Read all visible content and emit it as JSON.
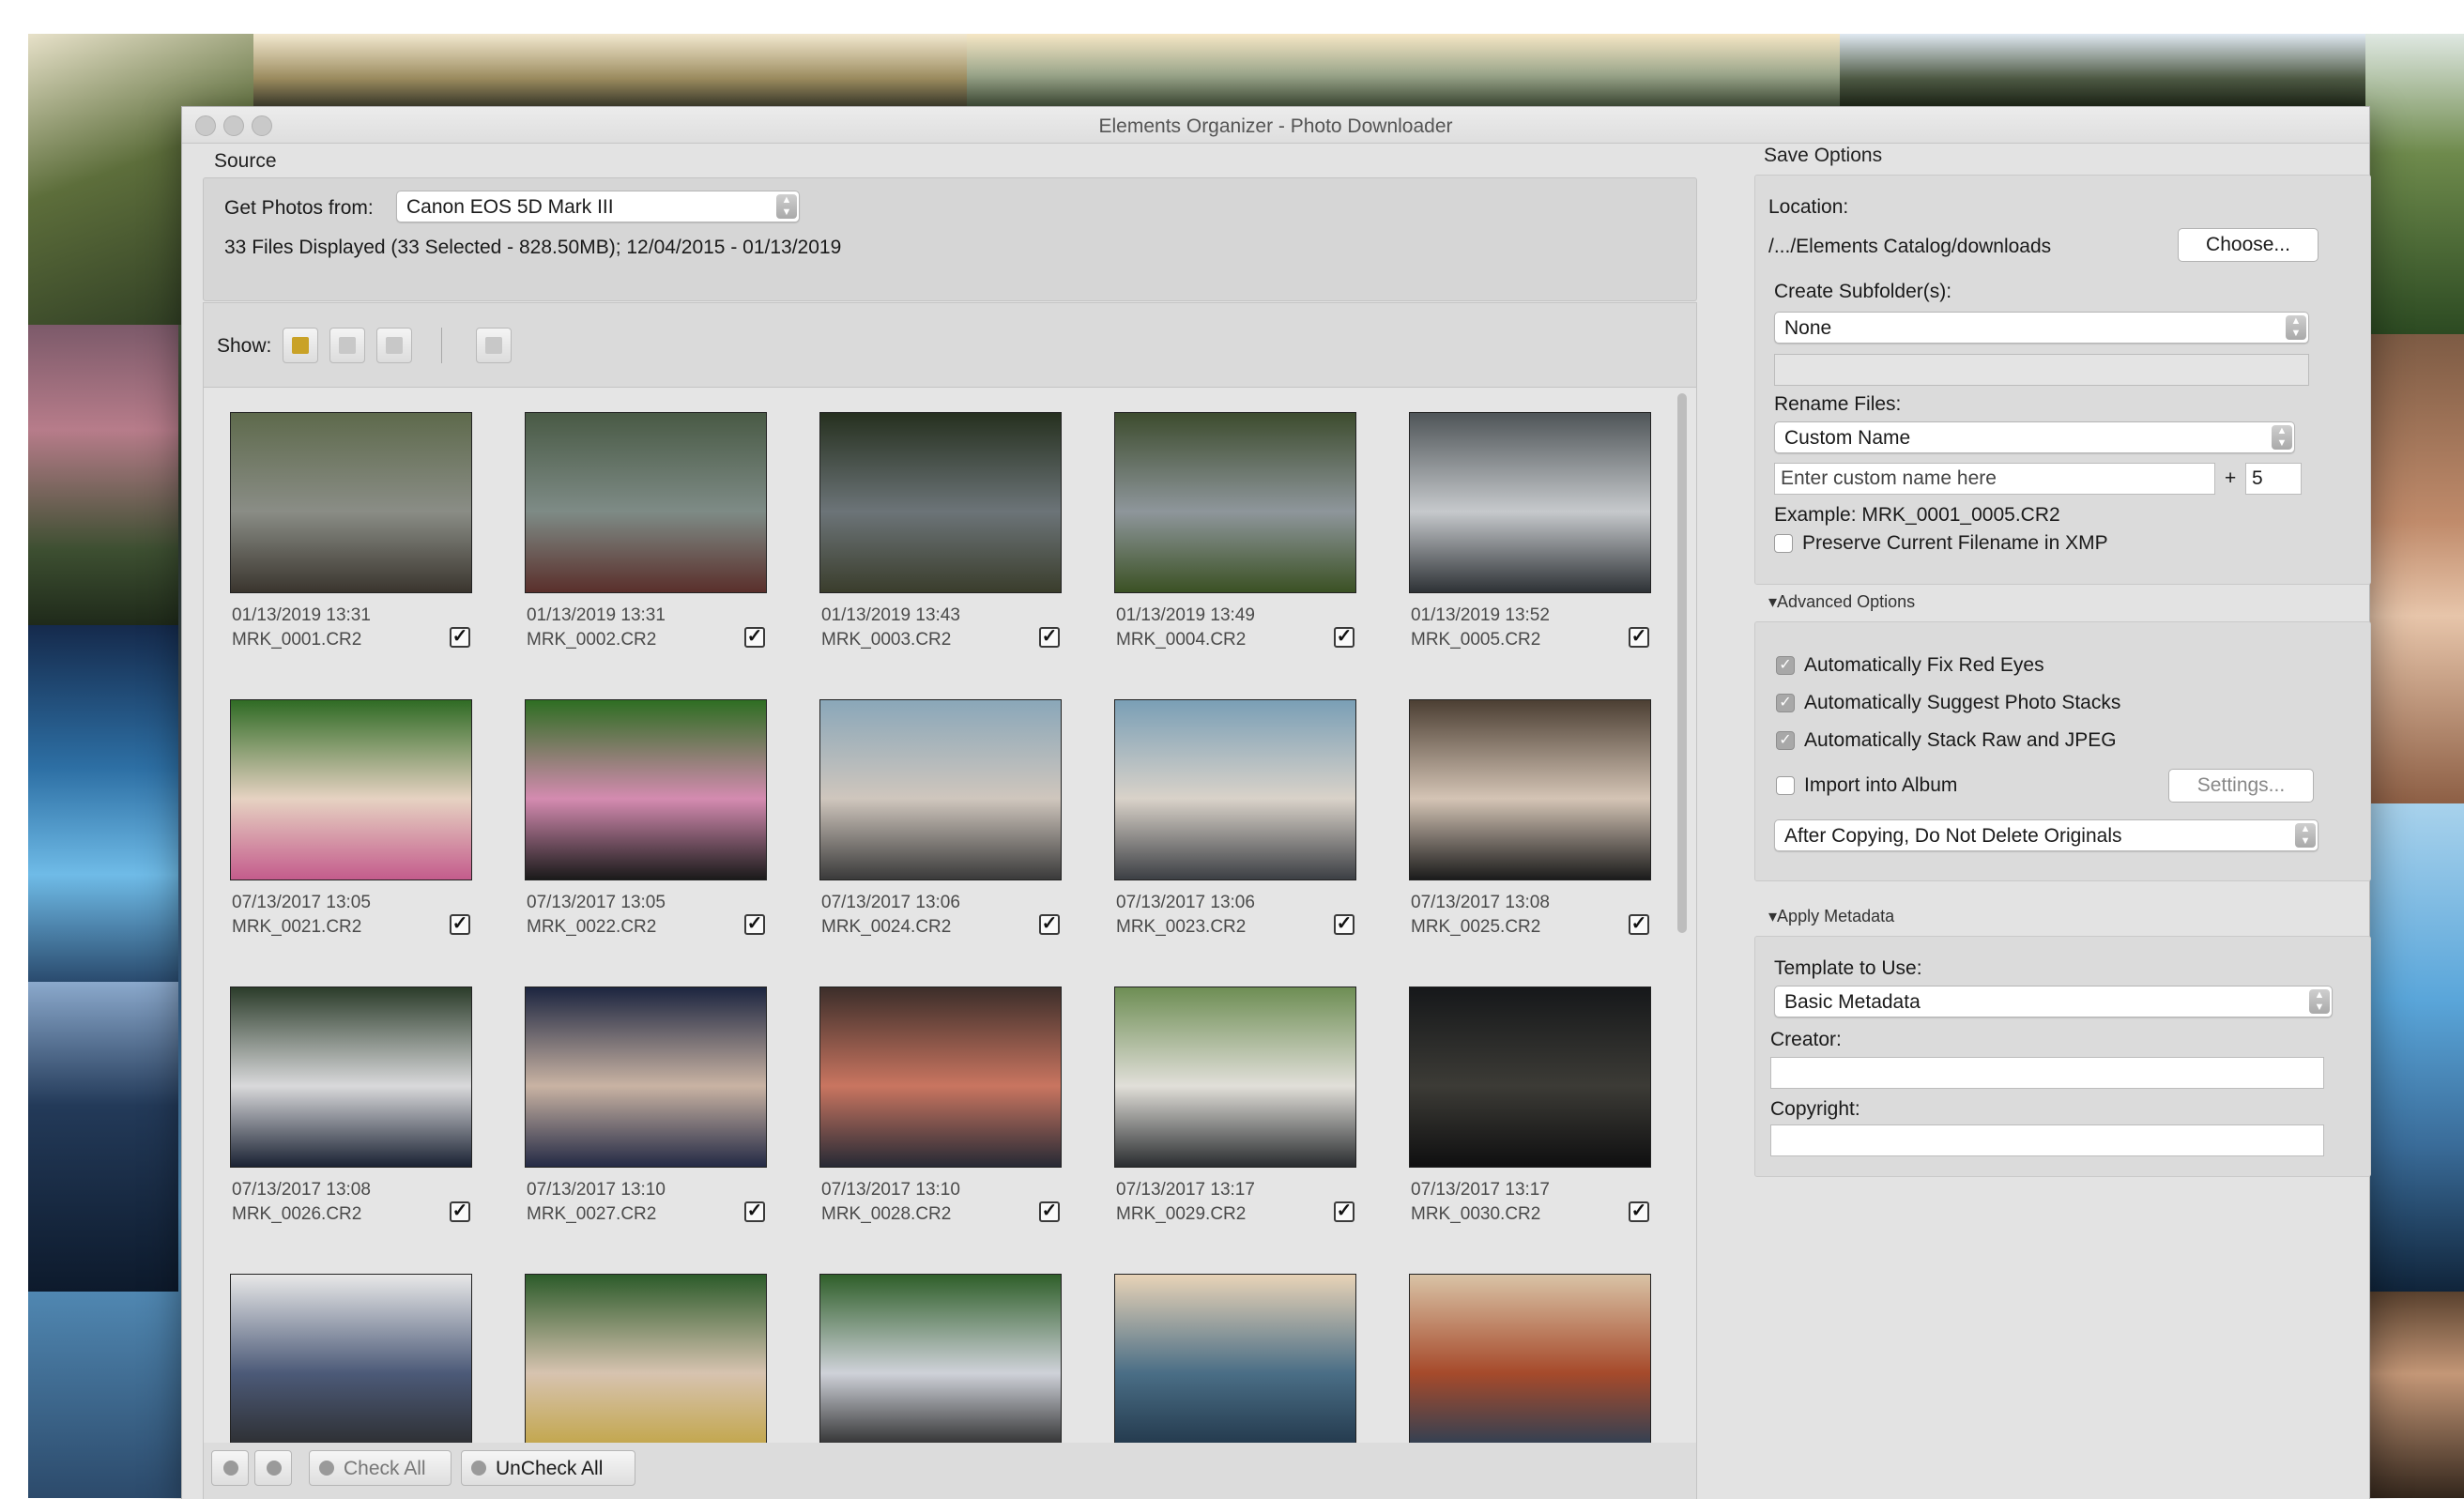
{
  "window": {
    "title": "Elements Organizer - Photo Downloader"
  },
  "source": {
    "section_label": "Source",
    "get_photos_label": "Get Photos from:",
    "device": "Canon EOS 5D Mark III",
    "summary": "33 Files Displayed (33 Selected - 828.50MB); 12/04/2015 - 01/13/2019",
    "show_label": "Show:"
  },
  "thumbnails": [
    {
      "date": "01/13/2019 13:31",
      "file": "MRK_0001.CR2",
      "checked": true,
      "colors": [
        "#5e6a4c",
        "#8a8d86",
        "#3a352e"
      ]
    },
    {
      "date": "01/13/2019 13:31",
      "file": "MRK_0002.CR2",
      "checked": true,
      "colors": [
        "#495a45",
        "#7e8b86",
        "#5a2f2b"
      ]
    },
    {
      "date": "01/13/2019 13:43",
      "file": "MRK_0003.CR2",
      "checked": true,
      "colors": [
        "#26301f",
        "#6c7478",
        "#3a3d2c"
      ]
    },
    {
      "date": "01/13/2019 13:49",
      "file": "MRK_0004.CR2",
      "checked": true,
      "colors": [
        "#3d4c2e",
        "#8e969b",
        "#3b5124"
      ]
    },
    {
      "date": "01/13/2019 13:52",
      "file": "MRK_0005.CR2",
      "checked": true,
      "colors": [
        "#4f5558",
        "#c6c9cc",
        "#2e3236"
      ]
    },
    {
      "date": "07/13/2017 13:05",
      "file": "MRK_0021.CR2",
      "checked": true,
      "colors": [
        "#2f6b24",
        "#e6d2c2",
        "#c45c8c"
      ]
    },
    {
      "date": "07/13/2017 13:05",
      "file": "MRK_0022.CR2",
      "checked": true,
      "colors": [
        "#2e6e22",
        "#d48bb0",
        "#1a1a1a"
      ]
    },
    {
      "date": "07/13/2017 13:06",
      "file": "MRK_0024.CR2",
      "checked": true,
      "colors": [
        "#8aa7b9",
        "#cfc6bd",
        "#3a3a3a"
      ]
    },
    {
      "date": "07/13/2017 13:06",
      "file": "MRK_0023.CR2",
      "checked": true,
      "colors": [
        "#7a9fb6",
        "#d9d2c9",
        "#3c3f44"
      ]
    },
    {
      "date": "07/13/2017 13:08",
      "file": "MRK_0025.CR2",
      "checked": true,
      "colors": [
        "#4c3f33",
        "#d4c4b5",
        "#1b1b1b"
      ]
    },
    {
      "date": "07/13/2017 13:08",
      "file": "MRK_0026.CR2",
      "checked": true,
      "colors": [
        "#2b3c2a",
        "#d9d9db",
        "#1a2233"
      ]
    },
    {
      "date": "07/13/2017 13:10",
      "file": "MRK_0027.CR2",
      "checked": true,
      "colors": [
        "#1c2540",
        "#c9b3a3",
        "#242a45"
      ]
    },
    {
      "date": "07/13/2017 13:10",
      "file": "MRK_0028.CR2",
      "checked": true,
      "colors": [
        "#3c2e2a",
        "#c97560",
        "#272a35"
      ]
    },
    {
      "date": "07/13/2017 13:17",
      "file": "MRK_0029.CR2",
      "checked": true,
      "colors": [
        "#6e8e54",
        "#e1dfd9",
        "#2a2d30"
      ]
    },
    {
      "date": "07/13/2017 13:17",
      "file": "MRK_0030.CR2",
      "checked": true,
      "colors": [
        "#16181a",
        "#3c3b36",
        "#0f0f10"
      ]
    },
    {
      "date": "",
      "file": "",
      "checked": true,
      "colors": [
        "#e8e8e8",
        "#4c5a78",
        "#2a2a2a"
      ]
    },
    {
      "date": "",
      "file": "",
      "checked": true,
      "colors": [
        "#2c5b2a",
        "#d7c3b0",
        "#c0a340"
      ]
    },
    {
      "date": "",
      "file": "",
      "checked": true,
      "colors": [
        "#2f5f2a",
        "#cfd2d9",
        "#1e1e1e"
      ]
    },
    {
      "date": "",
      "file": "",
      "checked": true,
      "colors": [
        "#e8d3b7",
        "#4a6e86",
        "#1f3346"
      ]
    },
    {
      "date": "",
      "file": "",
      "checked": true,
      "colors": [
        "#d9c3a6",
        "#a64a2b",
        "#233f58"
      ]
    }
  ],
  "bottom_bar": {
    "check_all": "Check All",
    "uncheck_all": "UnCheck All"
  },
  "save_options": {
    "section_label": "Save Options",
    "location_label": "Location:",
    "location_path": "/.../Elements Catalog/downloads",
    "choose_button": "Choose...",
    "subfolder_label": "Create Subfolder(s):",
    "subfolder_value": "None",
    "rename_label": "Rename Files:",
    "rename_value": "Custom Name",
    "custom_name_placeholder": "Enter custom name here",
    "plus": "+",
    "number": "5",
    "example": "Example: MRK_0001_0005.CR2",
    "preserve_label": "Preserve Current Filename in XMP"
  },
  "advanced_options": {
    "section_label": "Advanced Options",
    "fix_red_eyes": "Automatically Fix Red Eyes",
    "suggest_stacks": "Automatically Suggest Photo Stacks",
    "stack_raw_jpeg": "Automatically Stack Raw and JPEG",
    "import_album": "Import into Album",
    "settings_button": "Settings...",
    "after_copying": "After Copying, Do Not Delete Originals"
  },
  "apply_metadata": {
    "section_label": "Apply Metadata",
    "template_label": "Template to Use:",
    "template_value": "Basic Metadata",
    "creator_label": "Creator:",
    "copyright_label": "Copyright:"
  },
  "colors": {
    "accent_blue": "#3b73d6",
    "window_bg": "#e3e3e3"
  }
}
